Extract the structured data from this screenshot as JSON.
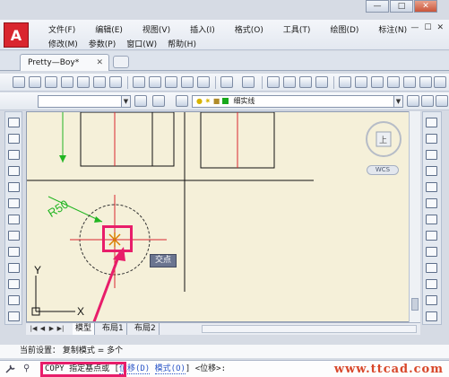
{
  "window": {
    "controls": [
      "—",
      "□",
      "✕"
    ]
  },
  "app": {
    "logo": "A"
  },
  "menu": {
    "row1": [
      "文件(F)",
      "编辑(E)",
      "视图(V)",
      "插入(I)",
      "格式(O)",
      "工具(T)",
      "绘图(D)",
      "标注(N)"
    ],
    "row2": [
      "修改(M)",
      "参数(P)",
      "窗口(W)",
      "帮助(H)"
    ],
    "doc_controls": [
      "—",
      "☐",
      "✕"
    ]
  },
  "tabs": {
    "document": "Pretty—Boy*",
    "close": "✕"
  },
  "toolbar2": {
    "style_combo": "",
    "linetype": "细实线"
  },
  "canvas": {
    "dimension_label": "R50",
    "wcs": "WCS",
    "nav_top": "上",
    "tooltip": "交点",
    "ucs_y": "Y",
    "ucs_x": "X"
  },
  "layout_tabs": {
    "nav": [
      "|◀",
      "◀",
      "▶",
      "▶|"
    ],
    "items": [
      "模型",
      "布局1",
      "布局2"
    ]
  },
  "command": {
    "history": "当前设置：  复制模式 = 多个",
    "prefix": "COPY",
    "prompt": "指定基点或",
    "bracket_open": "[",
    "option1": "位移(D)",
    "option2": "模式(O)",
    "bracket_close": "]",
    "default": "<位移>:"
  },
  "watermark": "www.ttcad.com",
  "colors": {
    "canvas_bg": "#f5f0d9",
    "highlight": "#e81d6a",
    "dimension": "#22b522",
    "center_line": "#d9262f"
  }
}
